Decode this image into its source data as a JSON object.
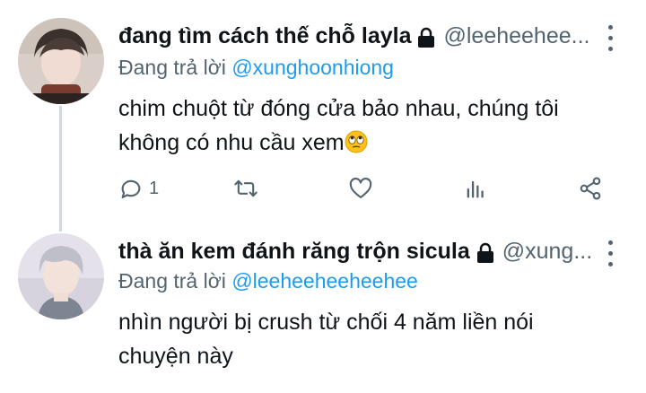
{
  "tweets": [
    {
      "display_name": "đang tìm cách thế chỗ layla",
      "handle": "@leeheehee...",
      "reply_prefix": "Đang trả lời ",
      "reply_mention": "@xunghoonhiong",
      "text_line1": "chim chuột từ đóng cửa bảo nhau, chúng tôi",
      "text_line2": "không có nhu cầu xem",
      "emoji": "face-with-rolling-eyes-emoji",
      "actions": {
        "reply_count": "1"
      }
    },
    {
      "display_name": "thà ăn kem đánh răng trộn sicula",
      "handle": "@xung...",
      "reply_prefix": "Đang trả lời ",
      "reply_mention": "@leeheeheeheehee",
      "text_line1": "nhìn người bị crush từ chối 4 năm liền nói",
      "text_line2": "chuyện này"
    }
  ],
  "colors": {
    "accent": "#1d9bf0",
    "secondary_text": "#536471",
    "thread_line": "#cfd9de",
    "icon": "#536471"
  },
  "icons": [
    "lock-icon",
    "more-icon",
    "reply-icon",
    "retweet-icon",
    "like-icon",
    "views-icon",
    "share-icon"
  ]
}
